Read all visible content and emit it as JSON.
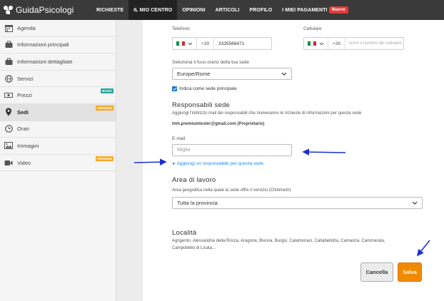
{
  "logo": {
    "text": "GuidaPsicologi"
  },
  "nav": [
    {
      "label": "RICHIESTE",
      "active": false
    },
    {
      "label": "IL MIO CENTRO",
      "active": true
    },
    {
      "label": "OPINIONI",
      "active": false
    },
    {
      "label": "ARTICOLI",
      "active": false
    },
    {
      "label": "PROFILO",
      "active": false
    },
    {
      "label": "I MIEI PAGAMENTI",
      "active": false
    }
  ],
  "nav_badge": "Nuovo",
  "sidebar": {
    "items": [
      {
        "label": "Agenda",
        "icon": "calendar-icon"
      },
      {
        "label": "Informazioni principali",
        "icon": "briefcase-icon"
      },
      {
        "label": "Informazioni dettagliate",
        "icon": "briefcase-icon"
      },
      {
        "label": "Servizi",
        "icon": "globe-icon"
      },
      {
        "label": "Prezzi",
        "icon": "money-icon",
        "tag": "BASIC"
      },
      {
        "label": "Sedi",
        "icon": "location-pin-icon",
        "tag": "PREMIUM",
        "active": true
      },
      {
        "label": "Orari",
        "icon": "clock-icon"
      },
      {
        "label": "Immagini",
        "icon": "image-icon"
      },
      {
        "label": "Video",
        "icon": "video-icon",
        "tag": "PREMIUM"
      }
    ]
  },
  "form": {
    "telefono_label": "Telefono",
    "telefono_prefix": "+39",
    "telefono_value": "3335566471",
    "cellulare_label": "Cellulare",
    "cellulare_prefix": "+39",
    "cellulare_placeholder": "Scrivi il numero del cellulare",
    "timezone_label": "Seleziona il fuso orario della tua sede",
    "timezone_value": "Europe/Rome",
    "main_checkbox_label": "Indica come sede principale",
    "resp_title": "Responsabili sede",
    "resp_desc": "Aggiungi l'indirizzo mail dei responsabili che riceveranno le richieste di informazioni per questa sede",
    "resp_owner": "tmh.premiumtester@gmail.com (Proprietario)",
    "email_label": "E-mail",
    "email_placeholder": "Miglia",
    "add_resp_link": "Aggiungi un responsabile per questa sede",
    "area_title": "Area di lavoro",
    "area_label": "Area geografica nella quale la sede offre il servizio (Chilometri)",
    "area_value": "Tutta la provincia",
    "localita_title": "Località",
    "localita_text_1": "Agrigento, Alessandria della Rocca, Aragona, Bivona, Burgio, Calamonaci, Caltabellotta, Camastra, Cammarata,",
    "localita_text_2": "Campobello di Licata..."
  },
  "buttons": {
    "cancel": "Cancella",
    "save": "Salva"
  },
  "colors": {
    "accent": "#f08a00",
    "nav_bg": "#3a3a3a",
    "link": "#1e88e5",
    "annotation_arrow": "#1a2fd4"
  }
}
